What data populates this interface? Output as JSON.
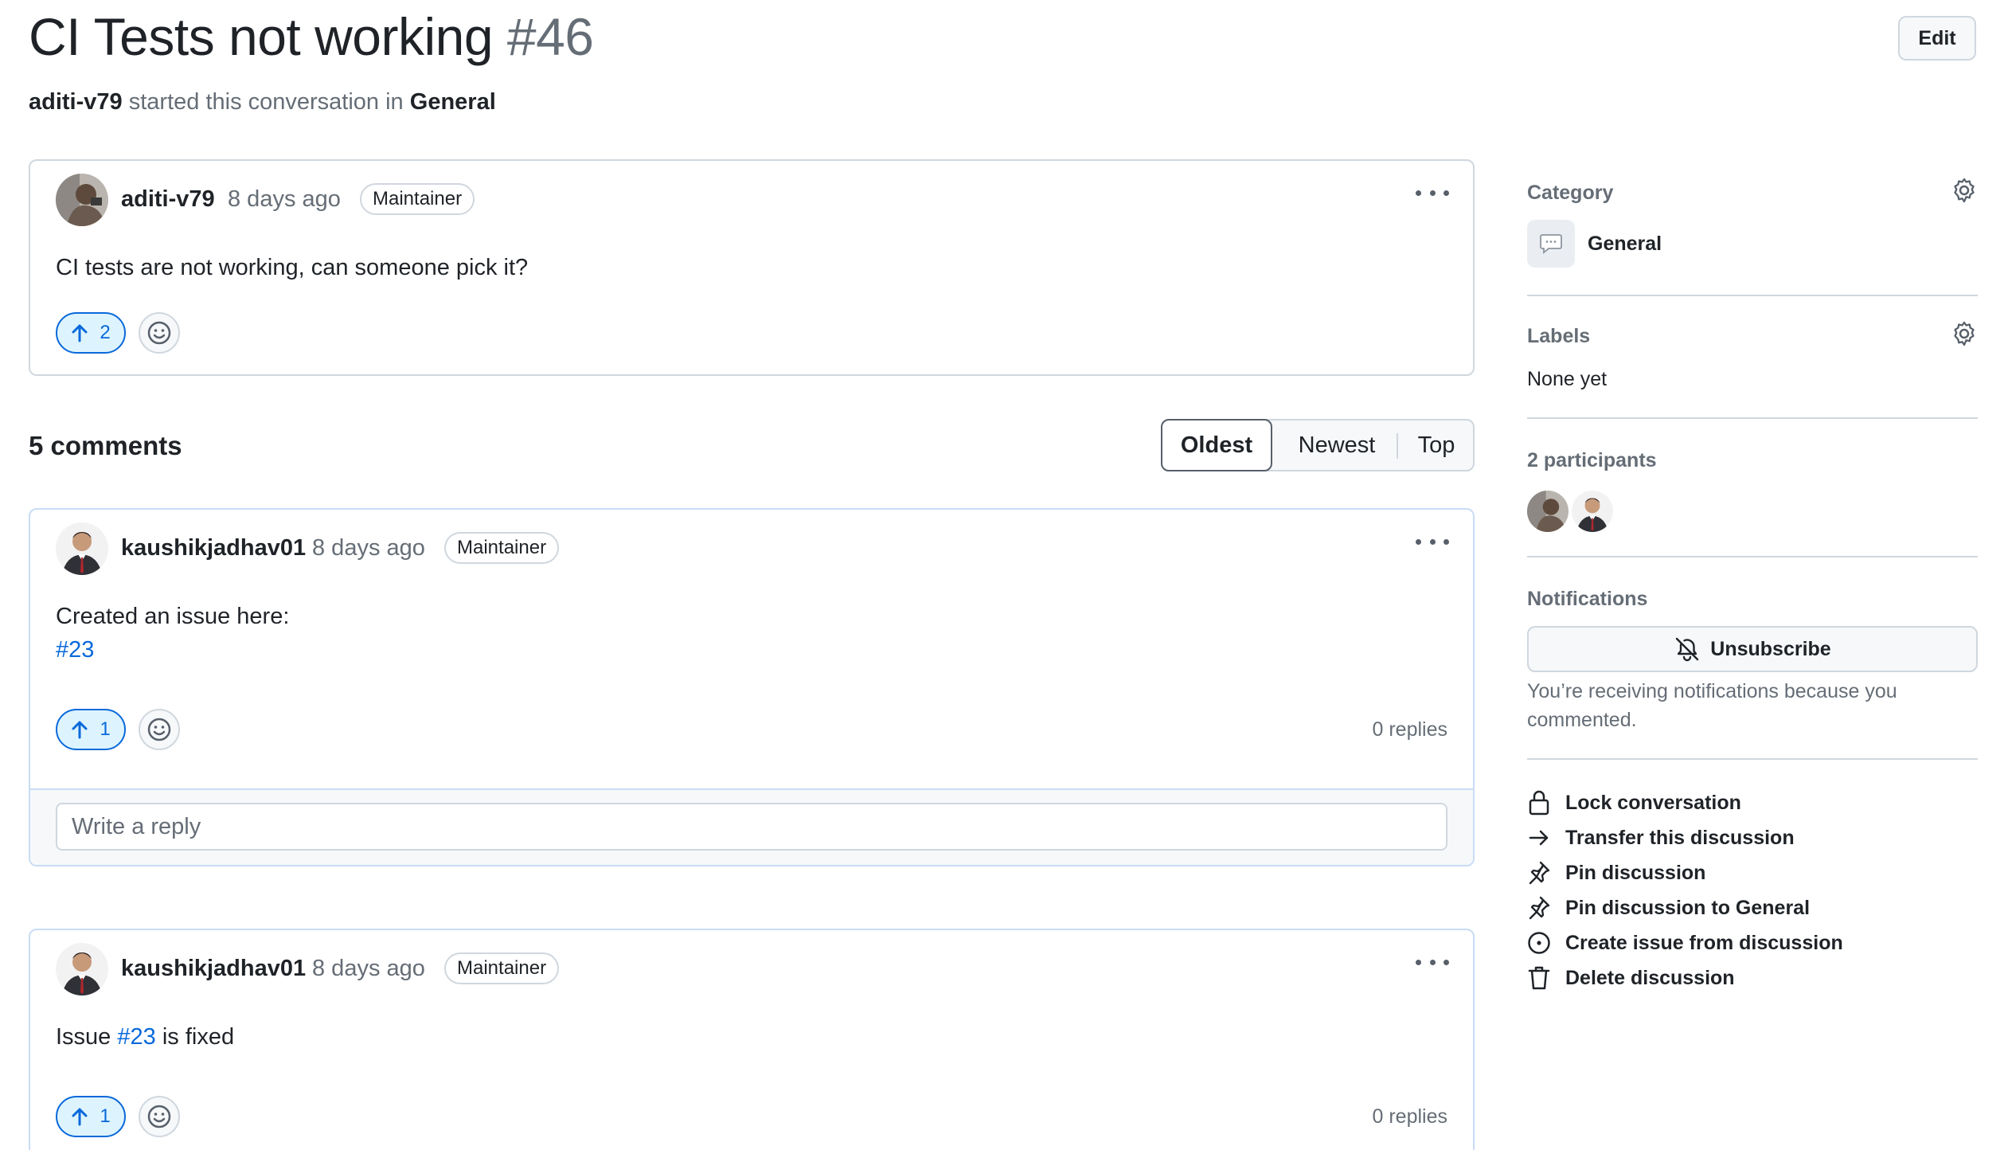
{
  "header": {
    "title": "CI Tests not working",
    "number": "#46",
    "author": "aditi-v79",
    "started_text": "started this conversation in",
    "category": "General",
    "edit_label": "Edit"
  },
  "post": {
    "author": "aditi-v79",
    "time": "8 days ago",
    "role": "Maintainer",
    "body": "CI tests are not working, can someone pick it?",
    "upvotes": "2"
  },
  "comments_section": {
    "count_label": "5 comments",
    "sort_options": [
      "Oldest",
      "Newest",
      "Top"
    ],
    "active_sort": "Oldest"
  },
  "comments": [
    {
      "author": "kaushikjadhav01",
      "time": "8 days ago",
      "role": "Maintainer",
      "line1": "Created an issue here:",
      "link": "#23",
      "upvotes": "1",
      "replies": "0 replies",
      "reply_placeholder": "Write a reply"
    },
    {
      "author": "kaushikjadhav01",
      "time": "8 days ago",
      "role": "Maintainer",
      "text_before": "Issue",
      "link": "#23",
      "text_after": "is fixed",
      "upvotes": "1",
      "replies": "0 replies"
    }
  ],
  "sidebar": {
    "category_heading": "Category",
    "category_value": "General",
    "labels_heading": "Labels",
    "labels_value": "None yet",
    "participants_heading": "2 participants",
    "notifications_heading": "Notifications",
    "unsubscribe_label": "Unsubscribe",
    "notify_reason": "You’re receiving notifications because you commented.",
    "actions": [
      {
        "label": "Lock conversation",
        "icon": "lock-icon"
      },
      {
        "label": "Transfer this discussion",
        "icon": "arrow-right-icon"
      },
      {
        "label": "Pin discussion",
        "icon": "pin-icon"
      },
      {
        "label": "Pin discussion to General",
        "icon": "pin-icon"
      },
      {
        "label": "Create issue from discussion",
        "icon": "issue-opened-icon"
      },
      {
        "label": "Delete discussion",
        "icon": "trash-icon"
      }
    ]
  },
  "colors": {
    "link": "#0969da",
    "muted": "#656d76",
    "border": "#d0d7de",
    "vote_bg": "#ddf4ff"
  }
}
